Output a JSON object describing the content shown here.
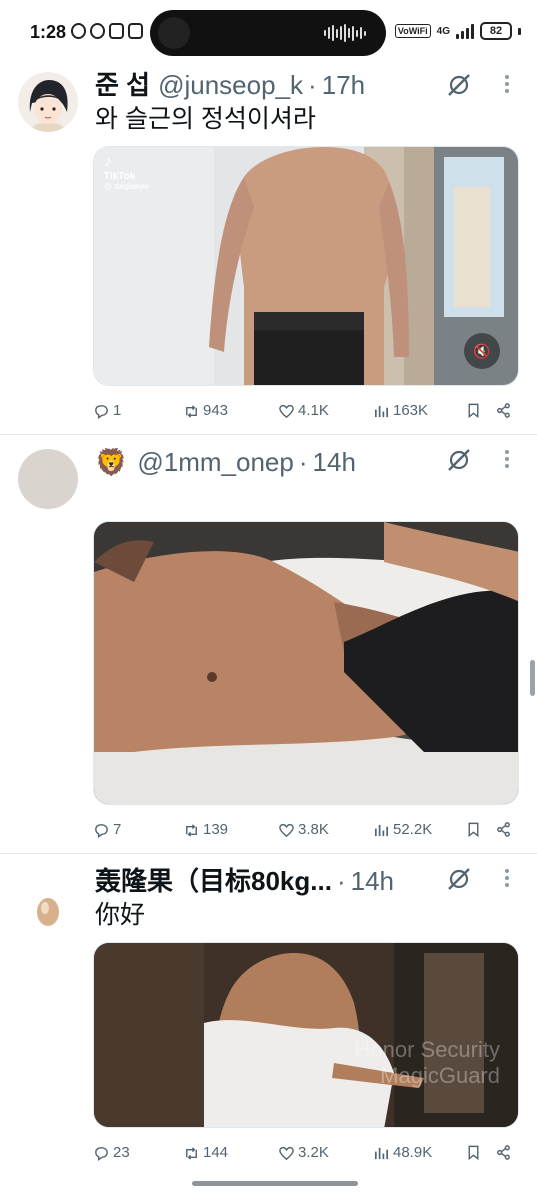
{
  "status_bar": {
    "time": "1:28",
    "network_label": "VoWiFi",
    "network_type": "4G",
    "battery_level": "82",
    "icons": [
      "alarm-icon",
      "headphones-icon",
      "clipboard-icon",
      "image-icon",
      "signal-icon",
      "battery-icon"
    ]
  },
  "tweets": [
    {
      "name": "준 섭",
      "handle": "@junseop_k",
      "time": "17h",
      "text": "와 슬근의 정석이셔라",
      "media": {
        "type": "video",
        "watermark_brand": "TikTok",
        "watermark_user": "@ daqianye",
        "muted": true
      },
      "replies": "1",
      "reposts": "943",
      "likes": "4.1K",
      "views": "163K"
    },
    {
      "name": "",
      "emoji": "🦁",
      "handle": "@1mm_onep",
      "time": "14h",
      "text": "",
      "media": {
        "type": "image"
      },
      "replies": "7",
      "reposts": "139",
      "likes": "3.8K",
      "views": "52.2K"
    },
    {
      "name": "轰隆果（目标80kg...",
      "handle": "",
      "time": "14h",
      "text": "你好",
      "media": {
        "type": "image",
        "watermark_line1": "Honor Security",
        "watermark_line2": "MagicGuard"
      },
      "replies": "23",
      "reposts": "144",
      "likes": "3.2K",
      "views": "48.9K"
    }
  ],
  "colors": {
    "text_primary": "#0f1419",
    "text_secondary": "#536471",
    "divider": "#e6e9ec"
  }
}
